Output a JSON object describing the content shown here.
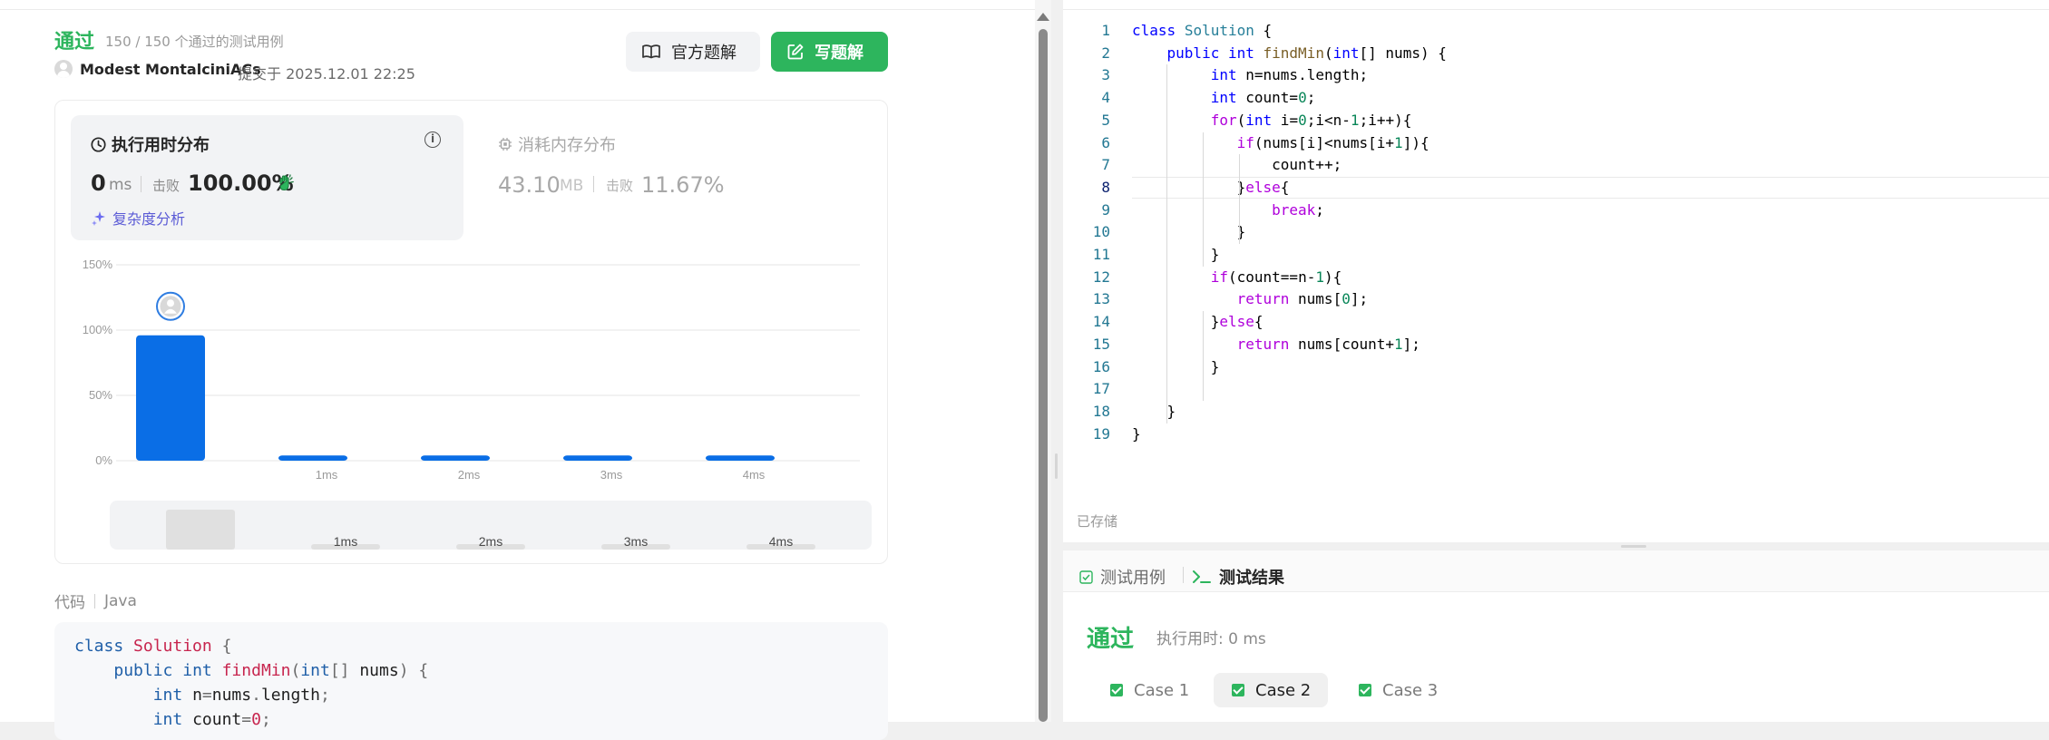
{
  "submission": {
    "status": "通过",
    "test_info": "150 / 150 个通过的测试用例",
    "username": "Modest MontalciniACs",
    "submitted": "提交于 2025.12.01 22:25",
    "official_solution": "官方题解",
    "write_solution": "写题解"
  },
  "runtime": {
    "title": "执行用时分布",
    "value": "0",
    "unit": "ms",
    "beat_label": "击败",
    "beat_pct": "100.00%",
    "complexity": "复杂度分析"
  },
  "memory": {
    "title": "消耗内存分布",
    "value": "43.10",
    "unit": "MB",
    "beat_label": "击败",
    "beat_pct": "11.67%"
  },
  "chart_data": {
    "type": "bar",
    "categories": [
      "",
      "1ms",
      "2ms",
      "3ms",
      "4ms"
    ],
    "values": [
      96,
      4,
      4,
      4,
      4
    ],
    "ylim": [
      0,
      150
    ],
    "yticks": [
      "0%",
      "50%",
      "100%",
      "150%"
    ],
    "bar_color": "#0a6ee6",
    "highlight_index": 0
  },
  "minimap": {
    "labels": [
      "1ms",
      "2ms",
      "3ms",
      "4ms"
    ],
    "values": [
      96,
      4,
      4,
      4,
      4
    ]
  },
  "code_section": {
    "label": "代码",
    "language": "Java",
    "lines": [
      "class Solution {",
      "    public int findMin(int[] nums) {",
      "        int n=nums.length;",
      "        int count=0;"
    ]
  },
  "editor": {
    "line_numbers": [
      "1",
      "2",
      "3",
      "4",
      "5",
      "6",
      "7",
      "8",
      "9",
      "10",
      "11",
      "12",
      "13",
      "14",
      "15",
      "16",
      "17",
      "18",
      "19"
    ],
    "active_line": 8,
    "lines": [
      "class Solution {",
      "    public int findMin(int[] nums) {",
      "         int n=nums.length;",
      "         int count=0;",
      "         for(int i=0;i<n-1;i++){",
      "            if(nums[i]<nums[i+1]){",
      "                count++;",
      "            }else{",
      "                break;",
      "            }",
      "         }",
      "         if(count==n-1){",
      "            return nums[0];",
      "         }else{",
      "            return nums[count+1];",
      "         }",
      "",
      "    }",
      "}"
    ],
    "saved": "已存储"
  },
  "console": {
    "tab_testcase": "测试用例",
    "tab_result": "测试结果",
    "status": "通过",
    "runtime": "执行用时: 0 ms",
    "cases": [
      "Case 1",
      "Case 2",
      "Case 3"
    ],
    "selected_case": "Case 2"
  },
  "colors": {
    "accepted": "#2db55d",
    "bar": "#0a6ee6",
    "complexity": "#5b5bd6"
  }
}
